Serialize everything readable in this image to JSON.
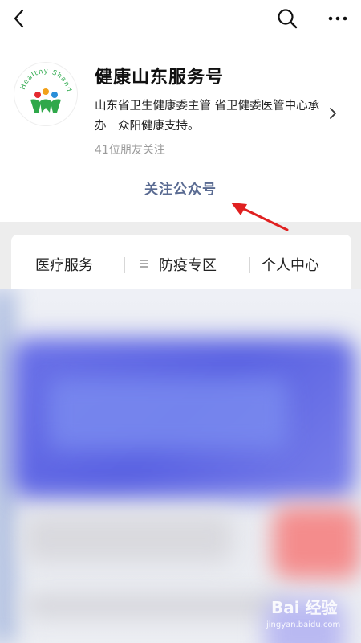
{
  "header": {
    "back_icon": "chevron-left-icon",
    "search_icon": "search-icon",
    "more_icon": "more-icon"
  },
  "account": {
    "logo_text": "Healthy Shandong",
    "name": "健康山东服务号",
    "description": "山东省卫生健康委主管 省卫健委医管中心承办　众阳健康支持。",
    "followers": "41位朋友关注",
    "follow_label": "关注公众号"
  },
  "menu": {
    "items": [
      {
        "label": "医疗服务"
      },
      {
        "label": "防疫专区",
        "icon": "menu-icon"
      },
      {
        "label": "个人中心"
      }
    ]
  },
  "watermark": {
    "text": "Bai 经验",
    "sub": "jingyan.baidu.com"
  },
  "colors": {
    "follow_text": "#5a6b92",
    "arrow": "#e02020",
    "banner": "#5a62e2"
  }
}
